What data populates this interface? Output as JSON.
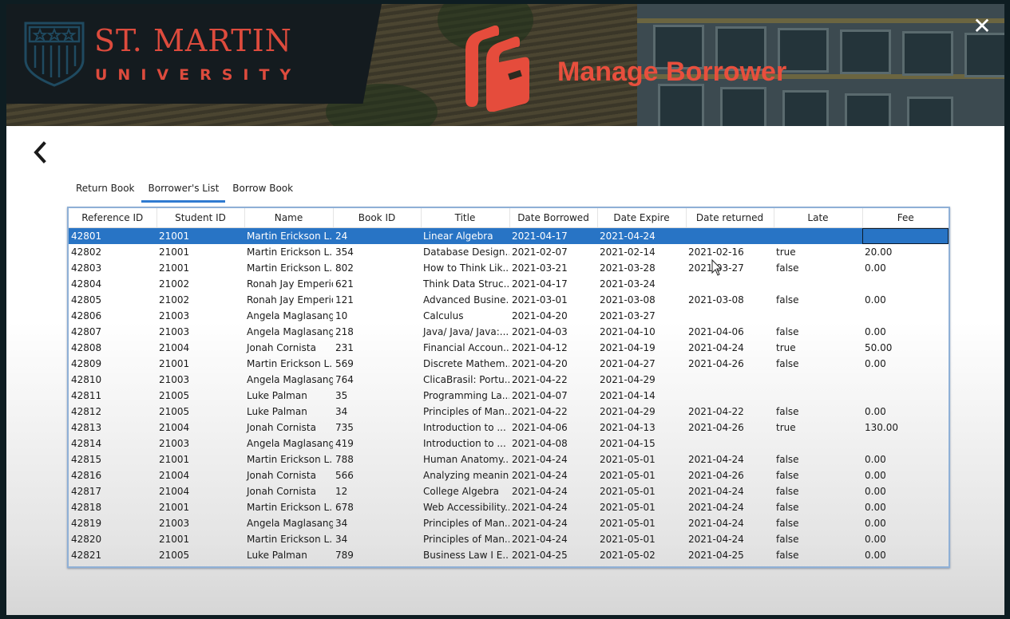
{
  "header": {
    "brand_line1": "ST. MARTIN",
    "brand_line2": "UNIVERSITY",
    "title": "Manage Borrower",
    "close_icon": "✕",
    "accent_color": "#e84f3d"
  },
  "nav": {
    "back_icon": "chevron-left"
  },
  "tabs": [
    {
      "label": "Return Book",
      "active": false
    },
    {
      "label": "Borrower's List",
      "active": true
    },
    {
      "label": "Borrow Book",
      "active": false
    }
  ],
  "table": {
    "columns": [
      "Reference ID",
      "Student ID",
      "Name",
      "Book ID",
      "Title",
      "Date Borrowed",
      "Date Expire",
      "Date returned",
      "Late",
      "Fee"
    ],
    "selected_row": 0,
    "rows": [
      [
        "42801",
        "21001",
        "Martin Erickson L...",
        "24",
        "Linear Algebra",
        "2021-04-17",
        "2021-04-24",
        "",
        "",
        ""
      ],
      [
        "42802",
        "21001",
        "Martin Erickson L...",
        "354",
        "Database Design...",
        "2021-02-07",
        "2021-02-14",
        "2021-02-16",
        "true",
        "20.00"
      ],
      [
        "42803",
        "21001",
        "Martin Erickson L...",
        "802",
        "How to Think Lik...",
        "2021-03-21",
        "2021-03-28",
        "2021-03-27",
        "false",
        "0.00"
      ],
      [
        "42804",
        "21002",
        "Ronah Jay Emperio",
        "621",
        "Think Data Struc...",
        "2021-04-17",
        "2021-03-24",
        "",
        "",
        ""
      ],
      [
        "42805",
        "21002",
        "Ronah Jay Emperio",
        "121",
        "Advanced Busine...",
        "2021-03-01",
        "2021-03-08",
        "2021-03-08",
        "false",
        "0.00"
      ],
      [
        "42806",
        "21003",
        "Angela Maglasang",
        "10",
        "Calculus",
        "2021-04-20",
        "2021-03-27",
        "",
        "",
        ""
      ],
      [
        "42807",
        "21003",
        "Angela Maglasang",
        "218",
        "Java/ Java/ Java:...",
        "2021-04-03",
        "2021-04-10",
        "2021-04-06",
        "false",
        "0.00"
      ],
      [
        "42808",
        "21004",
        "Jonah Cornista",
        "231",
        "Financial Accoun...",
        "2021-04-12",
        "2021-04-19",
        "2021-04-24",
        "true",
        "50.00"
      ],
      [
        "42809",
        "21001",
        "Martin Erickson L...",
        "569",
        "Discrete Mathem...",
        "2021-04-20",
        "2021-04-27",
        "2021-04-26",
        "false",
        "0.00"
      ],
      [
        "42810",
        "21003",
        "Angela Maglasang",
        "764",
        "ClicaBrasil: Portu...",
        "2021-04-22",
        "2021-04-29",
        "",
        "",
        ""
      ],
      [
        "42811",
        "21005",
        "Luke Palman",
        "35",
        "Programming La...",
        "2021-04-07",
        "2021-04-14",
        "",
        "",
        ""
      ],
      [
        "42812",
        "21005",
        "Luke Palman",
        "34",
        "Principles of Man...",
        "2021-04-22",
        "2021-04-29",
        "2021-04-22",
        "false",
        "0.00"
      ],
      [
        "42813",
        "21004",
        "Jonah Cornista",
        "735",
        "Introduction to ...",
        "2021-04-06",
        "2021-04-13",
        "2021-04-26",
        "true",
        "130.00"
      ],
      [
        "42814",
        "21003",
        "Angela Maglasang",
        "419",
        "Introduction to ...",
        "2021-04-08",
        "2021-04-15",
        "",
        "",
        ""
      ],
      [
        "42815",
        "21001",
        "Martin Erickson L...",
        "788",
        "Human Anatomy...",
        "2021-04-24",
        "2021-05-01",
        "2021-04-24",
        "false",
        "0.00"
      ],
      [
        "42816",
        "21004",
        "Jonah Cornista",
        "566",
        "Analyzing meanin...",
        "2021-04-24",
        "2021-05-01",
        "2021-04-26",
        "false",
        "0.00"
      ],
      [
        "42817",
        "21004",
        "Jonah Cornista",
        "12",
        "College Algebra",
        "2021-04-24",
        "2021-05-01",
        "2021-04-24",
        "false",
        "0.00"
      ],
      [
        "42818",
        "21001",
        "Martin Erickson L...",
        "678",
        "Web Accessibility...",
        "2021-04-24",
        "2021-05-01",
        "2021-04-24",
        "false",
        "0.00"
      ],
      [
        "42819",
        "21003",
        "Angela Maglasang",
        "34",
        "Principles of Man...",
        "2021-04-24",
        "2021-05-01",
        "2021-04-24",
        "false",
        "0.00"
      ],
      [
        "42820",
        "21001",
        "Martin Erickson L...",
        "34",
        "Principles of Man...",
        "2021-04-24",
        "2021-05-01",
        "2021-04-24",
        "false",
        "0.00"
      ],
      [
        "42821",
        "21005",
        "Luke Palman",
        "789",
        "Business Law I E...",
        "2021-04-25",
        "2021-05-02",
        "2021-04-25",
        "false",
        "0.00"
      ]
    ]
  }
}
